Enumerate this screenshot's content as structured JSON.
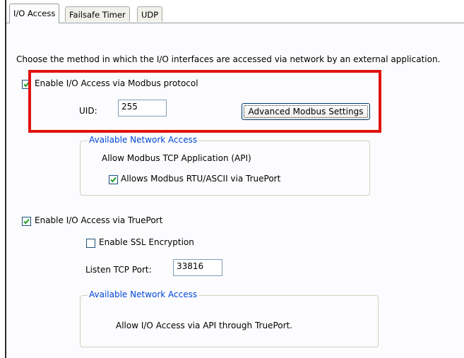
{
  "tabs": [
    {
      "label": "I/O Access",
      "active": true
    },
    {
      "label": "Failsafe Timer",
      "active": false
    },
    {
      "label": "UDP",
      "active": false
    }
  ],
  "description": "Choose the method in which the I/O interfaces are accessed via network by an external application.",
  "modbus": {
    "enable_label": "Enable I/O Access via Modbus protocol",
    "enabled": true,
    "uid_label": "UID:",
    "uid_value": "255",
    "advanced_button": "Advanced Modbus Settings",
    "group_title": "Available Network Access",
    "api_label": "Allow Modbus TCP Application (API)",
    "rtu_label": "Allows Modbus RTU/ASCII via TruePort",
    "rtu_checked": true
  },
  "trueport": {
    "enable_label": "Enable I/O Access via TruePort",
    "enabled": true,
    "ssl_label": "Enable SSL Encryption",
    "ssl_checked": false,
    "port_label": "Listen TCP Port:",
    "port_value": "33816",
    "group_title": "Available Network Access",
    "api_label": "Allow I/O Access via API through TruePort."
  },
  "colors": {
    "highlight": "#e0120e",
    "group_title": "#0046d5",
    "checkmark": "#21a121"
  }
}
